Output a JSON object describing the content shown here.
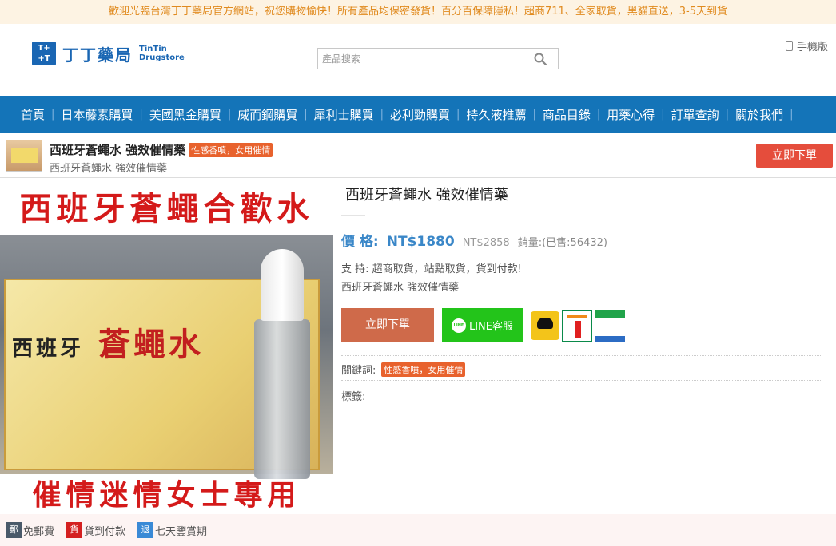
{
  "announcement": "歡迎光臨台灣丁丁藥局官方網站，祝您購物愉快！所有產品均保密發貨！百分百保障隱私！超商711、全家取貨，黑貓直送，3-5天到貨",
  "logo": {
    "mark": "T+ +T",
    "name": "丁丁藥局",
    "en_line1": "TinTin",
    "en_line2": "Drugstore"
  },
  "search": {
    "placeholder": "產品搜索",
    "value": ""
  },
  "mobile": {
    "label": "手機版"
  },
  "nav": [
    "首頁",
    "日本藤素購買",
    "美國黑金購買",
    "威而鋼購買",
    "犀利士購買",
    "必利勁購買",
    "持久液推薦",
    "商品目錄",
    "用藥心得",
    "訂單查詢",
    "關於我們"
  ],
  "product_bar": {
    "title": "西班牙蒼蠅水 強效催情藥",
    "tag": "性感香噴，女用催情",
    "subtitle": "西班牙蒼蠅水 強效催情藥",
    "buy_label": "立即下單"
  },
  "image": {
    "top_text": "西班牙蒼蠅合歡水",
    "box_prefix": "西班牙",
    "box_text": "蒼蠅水",
    "bottom_text": "催情迷情女士專用"
  },
  "product": {
    "title": "西班牙蒼蠅水 強效催情藥",
    "price_label": "價 格:",
    "price": "NT$1880",
    "old_price": "NT$2858",
    "sold": "銷量:(已售:56432)",
    "support": "支 持:   超商取貨，站點取貨，貨到付款!",
    "desc": "西班牙蒼蠅水 強效催情藥",
    "buy_label": "立即下單",
    "line_label": "LINE客服",
    "line_icon": "LINE",
    "keywords_label": "關鍵詞:",
    "keyword_tag": "性感香噴，女用催情",
    "tags_label": "標籤:"
  },
  "footer": [
    {
      "icon": "郵",
      "label": "免郵費",
      "color": "#4a5a6a"
    },
    {
      "icon": "貨",
      "label": "貨到付款",
      "color": "#d42020"
    },
    {
      "icon": "退",
      "label": "七天鑒賞期",
      "color": "#3a8ad6"
    }
  ]
}
